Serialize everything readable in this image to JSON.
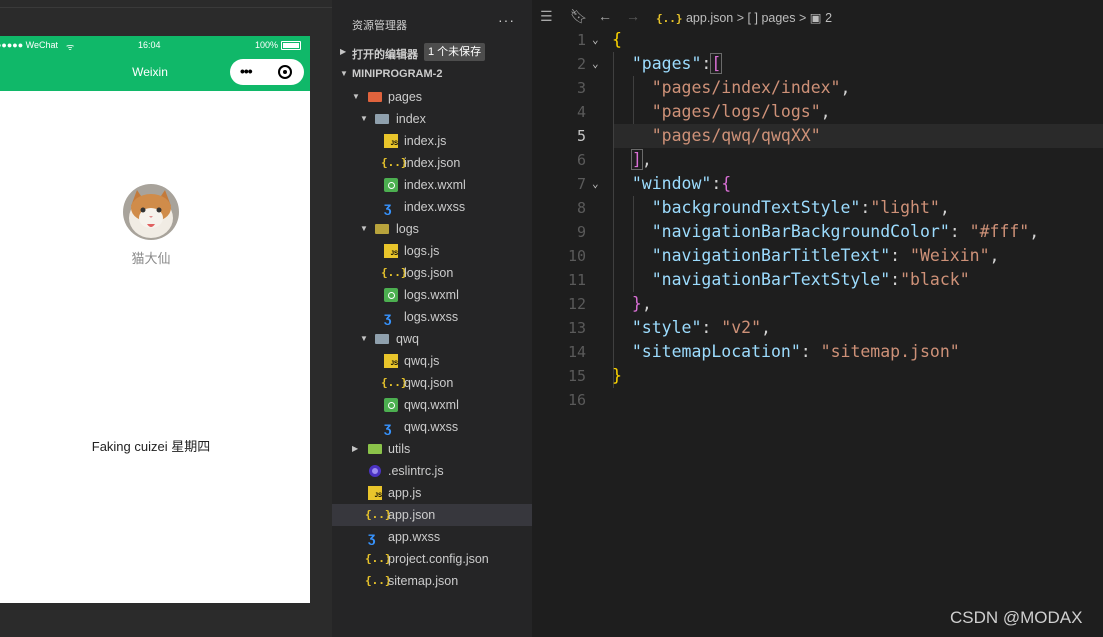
{
  "simulator": {
    "status_left": "●●●●● WeChat",
    "status_wifi": "ᯤ",
    "status_time": "16:04",
    "status_battery": "100%",
    "nav_title": "Weixin",
    "capsule_dots": "•••",
    "nickname": "猫大仙",
    "body_text": "Faking cuizei 星期四",
    "theme_color": "#10b869"
  },
  "explorer": {
    "title": "资源管理器",
    "more": "···",
    "open_editors_label": "打开的编辑器",
    "unsaved_badge": "1 个未保存",
    "project_name": "MINIPROGRAM-2",
    "tree": {
      "pages": "pages",
      "index": "index",
      "index_js": "index.js",
      "index_json": "index.json",
      "index_wxml": "index.wxml",
      "index_wxss": "index.wxss",
      "logs": "logs",
      "logs_js": "logs.js",
      "logs_json": "logs.json",
      "logs_wxml": "logs.wxml",
      "logs_wxss": "logs.wxss",
      "qwq": "qwq",
      "qwq_js": "qwq.js",
      "qwq_json": "qwq.json",
      "qwq_wxml": "qwq.wxml",
      "qwq_wxss": "qwq.wxss",
      "utils": "utils",
      "eslintrc": ".eslintrc.js",
      "app_js": "app.js",
      "app_json": "app.json",
      "app_wxss": "app.wxss",
      "project_config": "project.config.json",
      "sitemap": "sitemap.json"
    }
  },
  "editor": {
    "breadcrumb": {
      "json_icon": "{..}",
      "file": "app.json",
      "sep1": ">",
      "array_icon": "[ ]",
      "key": "pages",
      "sep2": ">",
      "index_icon": "▣",
      "index": "2"
    },
    "line_numbers": [
      "1",
      "2",
      "3",
      "4",
      "5",
      "6",
      "7",
      "8",
      "9",
      "10",
      "11",
      "12",
      "13",
      "14",
      "15",
      "16"
    ],
    "code": {
      "l1_open": "{",
      "l2_key": "\"pages\"",
      "l2_colon": ":",
      "l2_bracket": "[",
      "l3_val": "\"pages/index/index\"",
      "l3_comma": ",",
      "l4_val": "\"pages/logs/logs\"",
      "l4_comma": ",",
      "l5_val": "\"pages/qwq/qwqXX\"",
      "l6_bracket": "]",
      "l6_comma": ",",
      "l7_key": "\"window\"",
      "l7_colon": ":",
      "l7_brace": "{",
      "l8_key": "\"backgroundTextStyle\"",
      "l8_colon": ":",
      "l8_val": "\"light\"",
      "l8_comma": ",",
      "l9_key": "\"navigationBarBackgroundColor\"",
      "l9_colon": ": ",
      "l9_val": "\"#fff\"",
      "l9_comma": ",",
      "l10_key": "\"navigationBarTitleText\"",
      "l10_colon": ": ",
      "l10_val": "\"Weixin\"",
      "l10_comma": ",",
      "l11_key": "\"navigationBarTextStyle\"",
      "l11_colon": ":",
      "l11_val": "\"black\"",
      "l12_brace": "}",
      "l12_comma": ",",
      "l13_key": "\"style\"",
      "l13_colon": ": ",
      "l13_val": "\"v2\"",
      "l13_comma": ",",
      "l14_key": "\"sitemapLocation\"",
      "l14_colon": ": ",
      "l14_val": "\"sitemap.json\"",
      "l15_close": "}"
    },
    "active_line": "5"
  },
  "watermark": "CSDN @MODAX"
}
